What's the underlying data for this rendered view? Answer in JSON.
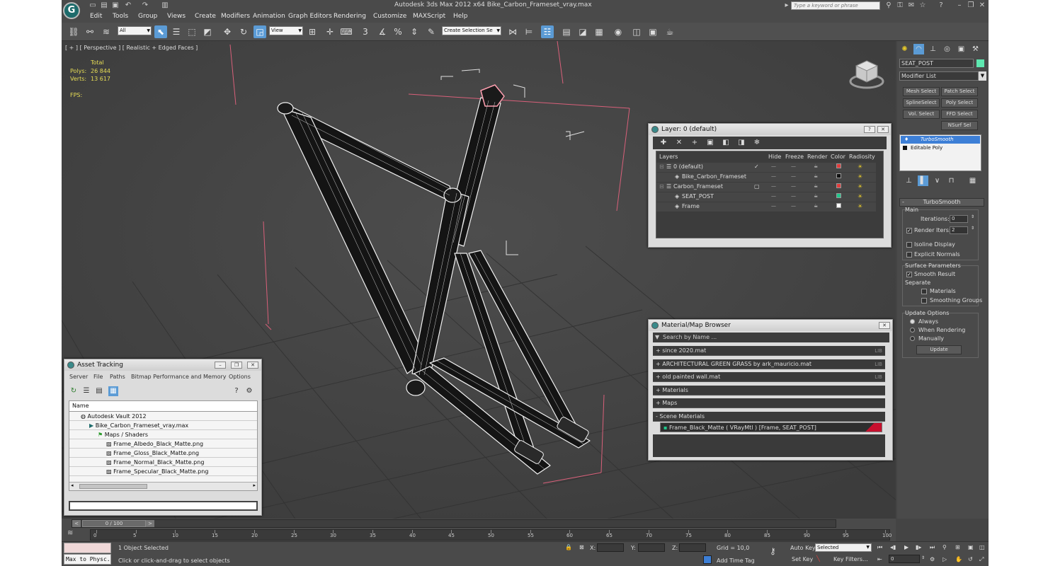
{
  "titlebar": {
    "app_title": "Autodesk 3ds Max  2012 x64     Bike_Carbon_Frameset_vray.max",
    "search_placeholder": "Type a keyword or phrase",
    "logo": "G"
  },
  "menubar": [
    "Edit",
    "Tools",
    "Group",
    "Views",
    "Create",
    "Modifiers",
    "Animation",
    "Graph Editors",
    "Rendering",
    "Customize",
    "MAXScript",
    "Help"
  ],
  "toolbar": {
    "filter_value": "All",
    "coord_value": "View",
    "selection_set_value": "Create Selection Se",
    "snap_label": "3"
  },
  "viewport": {
    "label": "[ + ] [ Perspective ] [ Realistic + Edged Faces ]",
    "stats": {
      "total_label": "Total",
      "polys_label": "Polys:",
      "polys_value": "26 844",
      "verts_label": "Verts:",
      "verts_value": "13 617",
      "fps_label": "FPS:"
    }
  },
  "layer_panel": {
    "title": "Layer: 0 (default)",
    "columns": [
      "Layers",
      "Hide",
      "Freeze",
      "Render",
      "Color",
      "Radiosity"
    ],
    "rows": [
      {
        "name": "0 (default)",
        "indent": 0,
        "color": "#e23c3c",
        "current": true
      },
      {
        "name": "Bike_Carbon_Frameset",
        "indent": 1,
        "color": "#111111"
      },
      {
        "name": "Carbon_Frameset",
        "indent": 0,
        "color": "#e23c3c",
        "current": false
      },
      {
        "name": "SEAT_POST",
        "indent": 1,
        "color": "#21c88c"
      },
      {
        "name": "Frame",
        "indent": 1,
        "color": "#ffffff"
      }
    ]
  },
  "material_browser": {
    "title": "Material/Map Browser",
    "search_placeholder": "Search by Name ...",
    "libraries": [
      {
        "label": "+ since 2020.mat",
        "tag": "LIB"
      },
      {
        "label": "+ ARCHITECTURAL GREEN GRASS by ark_mauricio.mat",
        "tag": "LIB"
      },
      {
        "label": "+ old painted wall.mat",
        "tag": "LIB"
      },
      {
        "label": "+ Materials",
        "tag": ""
      },
      {
        "label": "+ Maps",
        "tag": ""
      },
      {
        "label": "- Scene Materials",
        "tag": ""
      }
    ],
    "scene_material": "Frame_Black_Matte  ( VRayMtl )  [Frame, SEAT_POST]"
  },
  "asset_tracking": {
    "title": "Asset Tracking",
    "menu": [
      "Server",
      "File",
      "Paths",
      "Bitmap Performance and Memory",
      "Options"
    ],
    "column_header": "Name",
    "rows": [
      {
        "label": "Autodesk Vault 2012",
        "indent": 1
      },
      {
        "label": "Bike_Carbon_Frameset_vray.max",
        "indent": 2
      },
      {
        "label": "Maps / Shaders",
        "indent": 3
      },
      {
        "label": "Frame_Albedo_Black_Matte.png",
        "indent": 4
      },
      {
        "label": "Frame_Gloss_Black_Matte.png",
        "indent": 4
      },
      {
        "label": "Frame_Normal_Black_Matte.png",
        "indent": 4
      },
      {
        "label": "Frame_Specular_Black_Matte.png",
        "indent": 4
      }
    ]
  },
  "command_panel": {
    "object_name": "SEAT_POST",
    "object_color": "#5ee8b0",
    "modifier_list": "Modifier List",
    "buttons": [
      "Mesh Select",
      "Patch Select",
      "SplineSelect",
      "Poly Select",
      "Vol. Select",
      "FFD Select",
      "NSurf Sel"
    ],
    "stack": [
      "TurboSmooth",
      "Editable Poly"
    ],
    "rollout_title": "TurboSmooth",
    "main_label": "Main",
    "iterations_label": "Iterations:",
    "iterations_value": "0",
    "render_iters_label": "Render Iters:",
    "render_iters_value": "2",
    "isoline_label": "Isoline Display",
    "explicit_normals_label": "Explicit Normals",
    "surface_params_label": "Surface Parameters",
    "smooth_result_label": "Smooth Result",
    "separate_label": "Separate",
    "materials_label": "Materials",
    "smoothing_groups_label": "Smoothing Groups",
    "update_options_label": "Update Options",
    "always_label": "Always",
    "when_rendering_label": "When Rendering",
    "manually_label": "Manually",
    "update_button": "Update"
  },
  "timeline": {
    "frame_counter": "0 / 100",
    "ticks": [
      "0",
      "5",
      "10",
      "15",
      "20",
      "25",
      "30",
      "35",
      "40",
      "45",
      "50",
      "55",
      "60",
      "65",
      "70",
      "75",
      "80",
      "85",
      "90",
      "95",
      "100"
    ]
  },
  "statusbar": {
    "maxscript_label": "Max to Physc.",
    "selection_status": "1 Object Selected",
    "prompt": "Click or click-and-drag to select objects",
    "x_label": "X:",
    "y_label": "Y:",
    "z_label": "Z:",
    "grid": "Grid = 10,0",
    "add_time_tag": "Add Time Tag",
    "auto_key": "Auto Key",
    "set_key": "Set Key",
    "key_mode_value": "Selected",
    "key_filters": "Key Filters...",
    "current_frame": "0"
  },
  "colors": {
    "accent": "#5b9bd5",
    "selection": "#3d7fd6",
    "grid_line": "#2f2f2f",
    "gizmo": "#d9607a"
  }
}
